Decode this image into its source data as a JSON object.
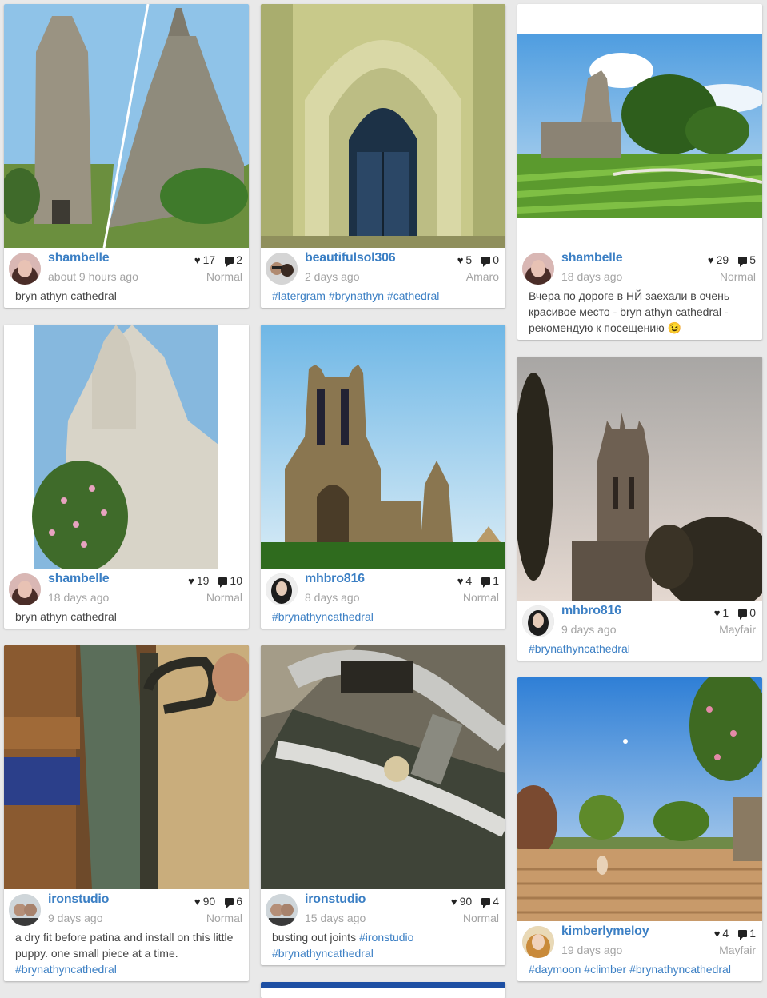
{
  "colors": {
    "link": "#3b7fc4",
    "muted": "#a4a4a4",
    "background": "#e9e9e9"
  },
  "icons": {
    "likes": "heart-icon",
    "comments": "comment-icon"
  },
  "posts": [
    {
      "user": "shambelle",
      "time": "about 9 hours ago",
      "likes": "17",
      "comments": "2",
      "filter": "Normal",
      "caption": [
        {
          "t": "bryn athyn cathedral",
          "tag": false
        }
      ]
    },
    {
      "user": "beautifulsol306",
      "time": "2 days ago",
      "likes": "5",
      "comments": "0",
      "filter": "Amaro",
      "caption": [
        {
          "t": "#latergram",
          "tag": true
        },
        {
          "t": " ",
          "tag": false
        },
        {
          "t": "#brynathyn",
          "tag": true
        },
        {
          "t": " ",
          "tag": false
        },
        {
          "t": "#cathedral",
          "tag": true
        }
      ]
    },
    {
      "user": "shambelle",
      "time": "18 days ago",
      "likes": "29",
      "comments": "5",
      "filter": "Normal",
      "caption": [
        {
          "t": "Вчера по дороге в НЙ заехали в очень красивое место - bryn athyn cathedral - рекомендую к посещению 😉",
          "tag": false
        }
      ]
    },
    {
      "user": "shambelle",
      "time": "18 days ago",
      "likes": "19",
      "comments": "10",
      "filter": "Normal",
      "caption": [
        {
          "t": "bryn athyn cathedral",
          "tag": false
        }
      ]
    },
    {
      "user": "mhbro816",
      "time": "8 days ago",
      "likes": "4",
      "comments": "1",
      "filter": "Normal",
      "caption": [
        {
          "t": "#brynathyncathedral",
          "tag": true
        }
      ]
    },
    {
      "user": "mhbro816",
      "time": "9 days ago",
      "likes": "1",
      "comments": "0",
      "filter": "Mayfair",
      "caption": [
        {
          "t": "#brynathyncathedral",
          "tag": true
        }
      ]
    },
    {
      "user": "ironstudio",
      "time": "9 days ago",
      "likes": "90",
      "comments": "6",
      "filter": "Normal",
      "caption": [
        {
          "t": "a dry fit before patina and install on this little puppy. one small piece at a time. ",
          "tag": false
        },
        {
          "t": "#brynathyncathedral",
          "tag": true
        }
      ]
    },
    {
      "user": "ironstudio",
      "time": "15 days ago",
      "likes": "90",
      "comments": "4",
      "filter": "Normal",
      "caption": [
        {
          "t": "busting out joints ",
          "tag": false
        },
        {
          "t": "#ironstudio",
          "tag": true
        },
        {
          "t": " ",
          "tag": false
        },
        {
          "t": "#brynathyncathedral",
          "tag": true
        }
      ]
    },
    {
      "user": "kimberlymeloy",
      "time": "19 days ago",
      "likes": "4",
      "comments": "1",
      "filter": "Mayfair",
      "caption": [
        {
          "t": "#daymoon",
          "tag": true
        },
        {
          "t": " ",
          "tag": false
        },
        {
          "t": "#climber",
          "tag": true
        },
        {
          "t": " ",
          "tag": false
        },
        {
          "t": "#brynathyncathedral",
          "tag": true
        }
      ]
    }
  ]
}
